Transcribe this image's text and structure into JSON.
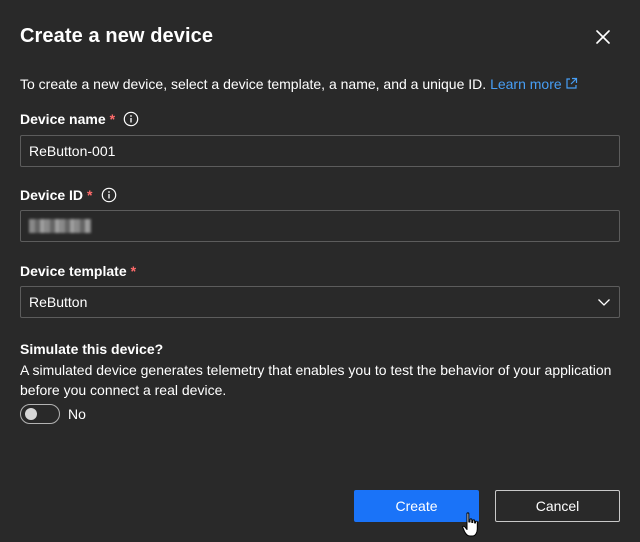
{
  "dialog": {
    "title": "Create a new device",
    "close_icon": "close-icon",
    "intro_text": "To create a new device, select a device template, a name, and a unique ID.",
    "learn_more_label": "Learn more"
  },
  "fields": {
    "device_name": {
      "label": "Device name",
      "required_mark": "*",
      "value": "ReButton-001"
    },
    "device_id": {
      "label": "Device ID",
      "required_mark": "*"
    },
    "device_template": {
      "label": "Device template",
      "required_mark": "*",
      "selected": "ReButton"
    }
  },
  "simulate": {
    "title": "Simulate this device?",
    "description": "A simulated device generates telemetry that enables you to test the behavior of your application before you connect a real device.",
    "toggle_on": false,
    "toggle_label": "No"
  },
  "buttons": {
    "create_label": "Create",
    "cancel_label": "Cancel"
  },
  "colors": {
    "background": "#292929",
    "primary": "#1a73f8",
    "link": "#479ef5",
    "required": "#ff6b6b",
    "border": "#5c5c5c"
  }
}
